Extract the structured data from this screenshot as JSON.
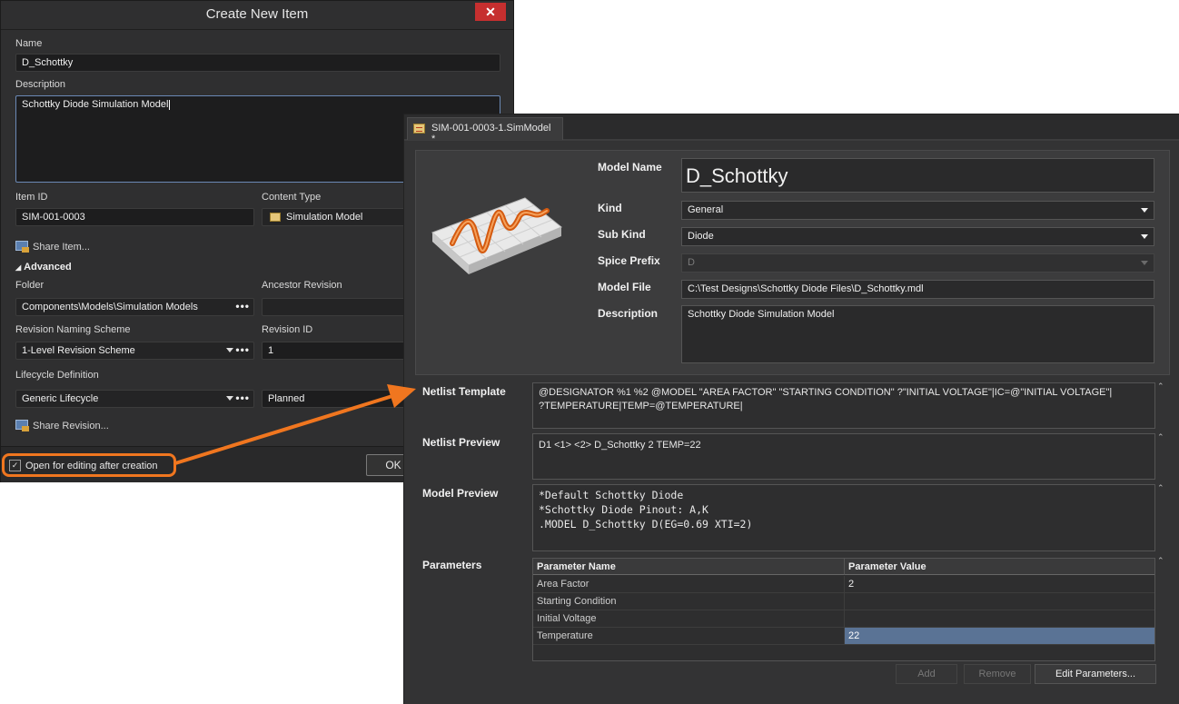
{
  "dialog": {
    "title": "Create New Item",
    "close_glyph": "✕",
    "name_label": "Name",
    "name_value": "D_Schottky",
    "description_label": "Description",
    "description_value": "Schottky Diode Simulation Model",
    "item_id_label": "Item ID",
    "item_id_value": "SIM-001-0003",
    "content_type_label": "Content Type",
    "content_type_value": "Simulation Model",
    "share_item_link": "Share Item...",
    "advanced_label": "Advanced",
    "folder_label": "Folder",
    "folder_value": "Components\\Models\\Simulation Models",
    "ancestor_revision_label": "Ancestor Revision",
    "revision_naming_label": "Revision Naming Scheme",
    "revision_naming_value": "1-Level Revision Scheme",
    "revision_id_label": "Revision ID",
    "revision_id_value": "1",
    "lifecycle_label": "Lifecycle Definition",
    "lifecycle_value": "Generic Lifecycle",
    "lifecycle_state_value": "Planned",
    "share_revision_link": "Share Revision...",
    "open_for_editing_label": "Open for editing after creation",
    "open_for_editing_checked": true,
    "ok_label": "OK",
    "ellipsis": "•••"
  },
  "editor": {
    "tab_label": "SIM-001-0003-1.SimModel *",
    "model_name_label": "Model Name",
    "model_name_value": "D_Schottky",
    "kind_label": "Kind",
    "kind_value": "General",
    "sub_kind_label": "Sub Kind",
    "sub_kind_value": "Diode",
    "spice_prefix_label": "Spice Prefix",
    "spice_prefix_value": "D",
    "model_file_label": "Model File",
    "model_file_value": "C:\\Test Designs\\Schottky Diode Files\\D_Schottky.mdl",
    "description_label": "Description",
    "description_value": "Schottky Diode Simulation Model",
    "netlist_template_label": "Netlist Template",
    "netlist_template_line1": "@DESIGNATOR %1 %2 @MODEL \"AREA FACTOR\" \"STARTING CONDITION\" ?\"INITIAL VOLTAGE\"|IC=@\"INITIAL VOLTAGE\"|",
    "netlist_template_line2": "?TEMPERATURE|TEMP=@TEMPERATURE|",
    "netlist_preview_label": "Netlist Preview",
    "netlist_preview_value": "D1 <1> <2> D_Schottky 2  TEMP=22",
    "model_preview_label": "Model Preview",
    "model_preview_lines": [
      "*Default Schottky Diode",
      "*Schottky Diode Pinout: A,K",
      ".MODEL D_Schottky D(EG=0.69 XTI=2)"
    ],
    "parameters_label": "Parameters",
    "param_col_name": "Parameter Name",
    "param_col_value": "Parameter Value",
    "parameters": [
      {
        "name": "Area Factor",
        "value": "2"
      },
      {
        "name": "Starting Condition",
        "value": ""
      },
      {
        "name": "Initial Voltage",
        "value": ""
      },
      {
        "name": "Temperature",
        "value": "22"
      }
    ],
    "add_button": "Add",
    "remove_button": "Remove",
    "edit_parameters_button": "Edit Parameters...",
    "collapse_glyph": "⌃"
  },
  "colors": {
    "highlight": "#f0761f",
    "selected_row": "#5a7395",
    "close_button": "#c62f2f"
  }
}
